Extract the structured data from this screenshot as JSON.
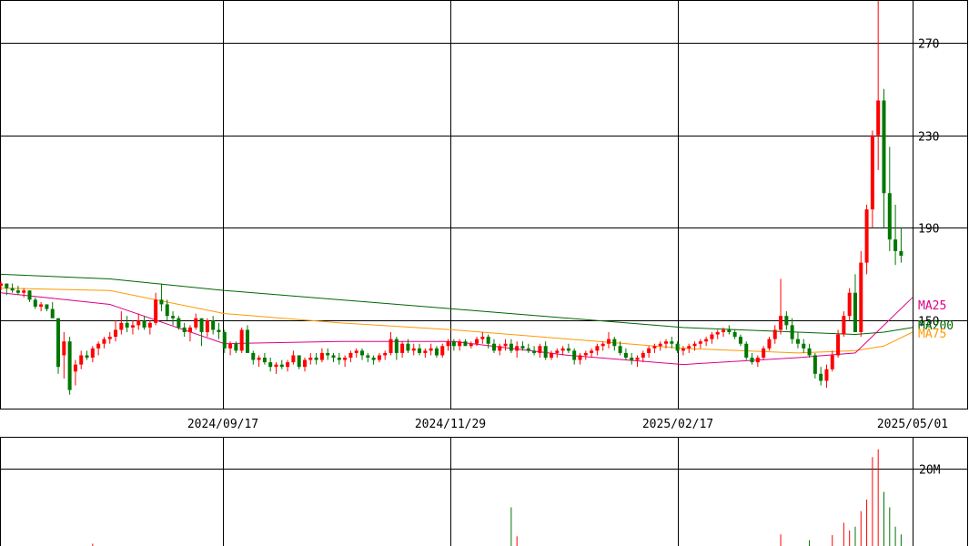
{
  "chart_data": [
    {
      "type": "candlestick",
      "title": "",
      "price_axis": {
        "ticks": [
          150,
          190,
          230,
          270
        ],
        "ylim": [
          112,
          288
        ]
      },
      "x_axis": {
        "labels": [
          "2024/09/17",
          "2024/11/29",
          "2025/02/17",
          "2025/05/01"
        ]
      },
      "colors": {
        "up": "#ff0000",
        "down": "#007700",
        "ma25": "#dd0088",
        "ma75": "#ff9900",
        "ma200": "#006600"
      },
      "legend": [
        "MA25",
        "MA200",
        "MA75"
      ],
      "candles": [
        [
          1,
          165,
          167,
          163,
          166
        ],
        [
          2,
          166,
          166,
          161,
          164
        ],
        [
          3,
          164,
          166,
          162,
          163
        ],
        [
          4,
          163,
          165,
          161,
          162
        ],
        [
          5,
          162,
          164,
          160,
          163
        ],
        [
          6,
          163,
          163,
          158,
          159
        ],
        [
          7,
          159,
          160,
          155,
          156
        ],
        [
          8,
          156,
          158,
          154,
          157
        ],
        [
          9,
          157,
          157,
          154,
          155
        ],
        [
          10,
          155,
          158,
          152,
          151
        ],
        [
          11,
          151,
          151,
          127,
          130
        ],
        [
          12,
          135,
          145,
          125,
          141
        ],
        [
          13,
          141,
          143,
          118,
          120
        ],
        [
          14,
          128,
          133,
          122,
          131
        ],
        [
          15,
          131,
          137,
          129,
          135
        ],
        [
          16,
          135,
          137,
          133,
          134
        ],
        [
          17,
          134,
          139,
          132,
          138
        ],
        [
          18,
          138,
          141,
          135,
          140
        ],
        [
          19,
          140,
          143,
          138,
          142
        ],
        [
          20,
          142,
          145,
          140,
          143
        ],
        [
          21,
          143,
          150,
          141,
          146
        ],
        [
          22,
          146,
          154,
          144,
          149
        ],
        [
          23,
          149,
          152,
          145,
          147
        ],
        [
          24,
          147,
          150,
          144,
          148
        ],
        [
          25,
          148,
          153,
          146,
          150
        ],
        [
          26,
          150,
          152,
          146,
          147
        ],
        [
          27,
          147,
          150,
          144,
          149
        ],
        [
          28,
          149,
          162,
          148,
          159
        ],
        [
          29,
          159,
          166,
          154,
          157
        ],
        [
          30,
          157,
          159,
          150,
          152
        ],
        [
          31,
          152,
          154,
          148,
          151
        ],
        [
          32,
          151,
          152,
          146,
          147
        ],
        [
          33,
          147,
          149,
          143,
          145
        ],
        [
          34,
          145,
          148,
          141,
          147
        ],
        [
          35,
          147,
          153,
          146,
          151
        ],
        [
          36,
          151,
          150,
          139,
          145
        ],
        [
          37,
          145,
          151,
          143,
          150
        ],
        [
          38,
          150,
          152,
          144,
          146
        ],
        [
          39,
          146,
          149,
          142,
          145
        ],
        [
          40,
          145,
          146,
          136,
          138
        ],
        [
          41,
          138,
          141,
          135,
          140
        ],
        [
          42,
          140,
          141,
          136,
          137
        ],
        [
          43,
          137,
          147,
          136,
          146
        ],
        [
          44,
          146,
          148,
          145,
          136
        ],
        [
          45,
          136,
          137,
          131,
          133
        ],
        [
          46,
          133,
          135,
          130,
          134
        ],
        [
          47,
          134,
          136,
          131,
          132
        ],
        [
          48,
          132,
          134,
          128,
          130
        ],
        [
          49,
          130,
          132,
          127,
          131
        ],
        [
          50,
          131,
          133,
          129,
          130
        ],
        [
          51,
          130,
          133,
          128,
          132
        ],
        [
          52,
          132,
          137,
          131,
          135
        ],
        [
          53,
          135,
          135,
          129,
          130
        ],
        [
          54,
          130,
          134,
          128,
          133
        ],
        [
          55,
          133,
          136,
          131,
          134
        ],
        [
          56,
          134,
          136,
          131,
          133
        ],
        [
          57,
          133,
          138,
          132,
          136
        ],
        [
          58,
          136,
          138,
          133,
          135
        ],
        [
          59,
          135,
          136,
          132,
          134
        ],
        [
          60,
          134,
          136,
          131,
          133
        ],
        [
          61,
          133,
          135,
          130,
          134
        ],
        [
          62,
          134,
          137,
          132,
          136
        ],
        [
          63,
          136,
          138,
          134,
          137
        ],
        [
          64,
          137,
          138,
          133,
          135
        ],
        [
          65,
          135,
          136,
          132,
          134
        ],
        [
          66,
          134,
          135,
          131,
          133
        ],
        [
          67,
          133,
          136,
          132,
          135
        ],
        [
          68,
          135,
          137,
          133,
          136
        ],
        [
          69,
          136,
          145,
          135,
          142
        ],
        [
          70,
          142,
          143,
          133,
          136
        ],
        [
          71,
          136,
          141,
          134,
          140
        ],
        [
          72,
          140,
          142,
          136,
          137
        ],
        [
          73,
          137,
          140,
          135,
          138
        ],
        [
          74,
          138,
          140,
          135,
          136
        ],
        [
          75,
          136,
          138,
          134,
          137
        ],
        [
          76,
          137,
          140,
          135,
          138
        ],
        [
          77,
          138,
          139,
          134,
          135
        ],
        [
          78,
          135,
          140,
          134,
          139
        ],
        [
          79,
          139,
          142,
          137,
          141
        ],
        [
          80,
          141,
          142,
          137,
          139
        ],
        [
          81,
          139,
          142,
          137,
          141
        ],
        [
          82,
          141,
          142,
          140,
          139
        ],
        [
          83,
          139,
          141,
          138,
          140
        ],
        [
          84,
          140,
          143,
          139,
          142
        ],
        [
          85,
          142,
          145,
          140,
          143
        ],
        [
          86,
          143,
          144,
          138,
          140
        ],
        [
          87,
          140,
          142,
          136,
          137
        ],
        [
          88,
          137,
          140,
          135,
          139
        ],
        [
          89,
          139,
          142,
          137,
          140
        ],
        [
          90,
          140,
          142,
          136,
          137
        ],
        [
          91,
          137,
          141,
          134,
          139
        ],
        [
          92,
          139,
          141,
          137,
          138
        ],
        [
          93,
          138,
          140,
          136,
          137
        ],
        [
          94,
          137,
          139,
          135,
          136
        ],
        [
          95,
          136,
          140,
          134,
          139
        ],
        [
          96,
          139,
          141,
          133,
          134
        ],
        [
          97,
          134,
          137,
          133,
          136
        ],
        [
          98,
          136,
          138,
          134,
          137
        ],
        [
          99,
          137,
          139,
          135,
          138
        ],
        [
          100,
          138,
          140,
          136,
          137
        ],
        [
          101,
          137,
          138,
          131,
          133
        ],
        [
          102,
          133,
          136,
          131,
          135
        ],
        [
          103,
          135,
          137,
          133,
          136
        ],
        [
          104,
          136,
          138,
          134,
          137
        ],
        [
          105,
          137,
          140,
          135,
          139
        ],
        [
          106,
          139,
          141,
          137,
          140
        ],
        [
          107,
          140,
          145,
          138,
          142
        ],
        [
          108,
          142,
          143,
          137,
          139
        ],
        [
          109,
          139,
          141,
          135,
          136
        ],
        [
          110,
          136,
          138,
          133,
          134
        ],
        [
          111,
          134,
          136,
          131,
          133
        ],
        [
          112,
          133,
          135,
          130,
          134
        ],
        [
          113,
          134,
          137,
          132,
          136
        ],
        [
          114,
          136,
          139,
          134,
          138
        ],
        [
          115,
          138,
          140,
          136,
          139
        ],
        [
          116,
          139,
          141,
          137,
          140
        ],
        [
          117,
          140,
          142,
          138,
          141
        ],
        [
          118,
          141,
          143,
          138,
          140
        ],
        [
          119,
          140,
          141,
          136,
          137
        ],
        [
          120,
          137,
          139,
          135,
          138
        ],
        [
          121,
          138,
          140,
          136,
          139
        ],
        [
          122,
          139,
          141,
          137,
          140
        ],
        [
          123,
          140,
          142,
          138,
          141
        ],
        [
          124,
          141,
          143,
          139,
          142
        ],
        [
          125,
          142,
          145,
          140,
          144
        ],
        [
          126,
          144,
          146,
          142,
          145
        ],
        [
          127,
          145,
          147,
          143,
          146
        ],
        [
          128,
          146,
          148,
          144,
          145
        ],
        [
          129,
          145,
          146,
          142,
          143
        ],
        [
          130,
          143,
          144,
          139,
          140
        ],
        [
          131,
          140,
          141,
          133,
          134
        ],
        [
          132,
          134,
          136,
          131,
          132
        ],
        [
          133,
          132,
          135,
          130,
          134
        ],
        [
          134,
          134,
          139,
          133,
          138
        ],
        [
          135,
          138,
          143,
          137,
          142
        ],
        [
          136,
          142,
          148,
          140,
          146
        ],
        [
          137,
          146,
          168,
          144,
          152
        ],
        [
          138,
          152,
          154,
          146,
          148
        ],
        [
          139,
          148,
          151,
          140,
          142
        ],
        [
          140,
          142,
          145,
          138,
          140
        ],
        [
          141,
          140,
          142,
          136,
          138
        ],
        [
          142,
          138,
          140,
          134,
          135
        ],
        [
          143,
          135,
          136,
          125,
          127
        ],
        [
          144,
          127,
          130,
          122,
          124
        ],
        [
          145,
          124,
          131,
          121,
          129
        ],
        [
          146,
          129,
          137,
          128,
          135
        ],
        [
          147,
          135,
          146,
          134,
          144
        ],
        [
          148,
          144,
          154,
          143,
          152
        ],
        [
          149,
          152,
          164,
          150,
          162
        ],
        [
          150,
          162,
          170,
          150,
          145
        ],
        [
          151,
          145,
          180,
          143,
          175
        ],
        [
          152,
          175,
          200,
          170,
          198
        ],
        [
          153,
          198,
          232,
          190,
          230
        ],
        [
          154,
          230,
          288,
          215,
          245
        ],
        [
          155,
          245,
          250,
          190,
          205
        ],
        [
          156,
          205,
          225,
          180,
          185
        ],
        [
          157,
          185,
          200,
          174,
          180
        ],
        [
          158,
          180,
          190,
          175,
          178
        ]
      ],
      "ma25": [
        [
          1,
          162
        ],
        [
          20,
          157
        ],
        [
          40,
          140
        ],
        [
          60,
          141
        ],
        [
          80,
          141
        ],
        [
          100,
          135
        ],
        [
          120,
          131
        ],
        [
          140,
          134
        ],
        [
          150,
          136
        ],
        [
          155,
          148
        ],
        [
          160,
          160
        ]
      ],
      "ma75": [
        [
          1,
          164
        ],
        [
          20,
          163
        ],
        [
          40,
          153
        ],
        [
          60,
          149
        ],
        [
          80,
          146
        ],
        [
          100,
          142
        ],
        [
          120,
          138
        ],
        [
          140,
          136
        ],
        [
          150,
          137
        ],
        [
          155,
          139
        ],
        [
          160,
          145
        ]
      ],
      "ma200": [
        [
          1,
          170
        ],
        [
          20,
          168
        ],
        [
          40,
          163
        ],
        [
          60,
          159
        ],
        [
          80,
          155
        ],
        [
          100,
          151
        ],
        [
          120,
          147
        ],
        [
          140,
          145
        ],
        [
          150,
          144
        ],
        [
          155,
          145
        ],
        [
          160,
          147
        ]
      ],
      "volume_axis": {
        "ticks": [
          20
        ],
        "unit": "M",
        "label": "20M",
        "ylim": [
          0,
          28
        ]
      },
      "volume": [
        [
          17,
          0.6
        ],
        [
          90,
          10.0
        ],
        [
          91,
          2.5
        ],
        [
          137,
          3.0
        ],
        [
          142,
          1.5
        ],
        [
          146,
          2.8
        ],
        [
          148,
          6.0
        ],
        [
          149,
          4.0
        ],
        [
          150,
          5.0
        ],
        [
          151,
          9.0
        ],
        [
          152,
          12.0
        ],
        [
          153,
          23.0
        ],
        [
          154,
          25.0
        ],
        [
          155,
          14.0
        ],
        [
          156,
          10.0
        ],
        [
          157,
          5.0
        ],
        [
          158,
          3.0
        ]
      ]
    }
  ]
}
